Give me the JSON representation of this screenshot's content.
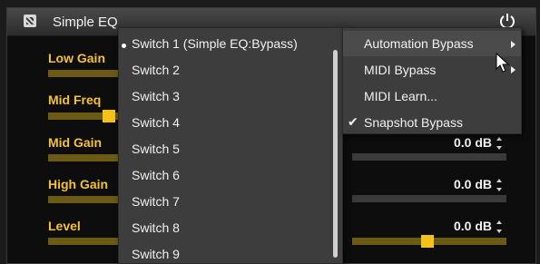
{
  "plugin": {
    "title": "Simple EQ",
    "icon": "eq-plugin-icon",
    "power_icon": "power-icon"
  },
  "params": [
    {
      "label": "Low Gain"
    },
    {
      "label": "Mid Freq"
    },
    {
      "label": "Mid Gain",
      "value": "0.0 dB"
    },
    {
      "label": "High Gain",
      "value": "0.0 dB"
    },
    {
      "label": "Level",
      "value": "0.0 dB"
    }
  ],
  "switch_menu": {
    "items": [
      "Switch 1 (Simple EQ:Bypass)",
      "Switch 2",
      "Switch 3",
      "Switch 4",
      "Switch 5",
      "Switch 6",
      "Switch 7",
      "Switch 8",
      "Switch 9"
    ]
  },
  "context_menu": {
    "items": [
      {
        "label": "Automation Bypass",
        "submenu": true,
        "highlighted": true
      },
      {
        "label": "MIDI Bypass",
        "submenu": true
      },
      {
        "label": "MIDI Learn..."
      },
      {
        "label": "Snapshot Bypass",
        "checked": true
      }
    ]
  },
  "colors": {
    "accent": "#f5c21a",
    "label": "#f4c233",
    "menu_bg": "#3d3d3d"
  }
}
